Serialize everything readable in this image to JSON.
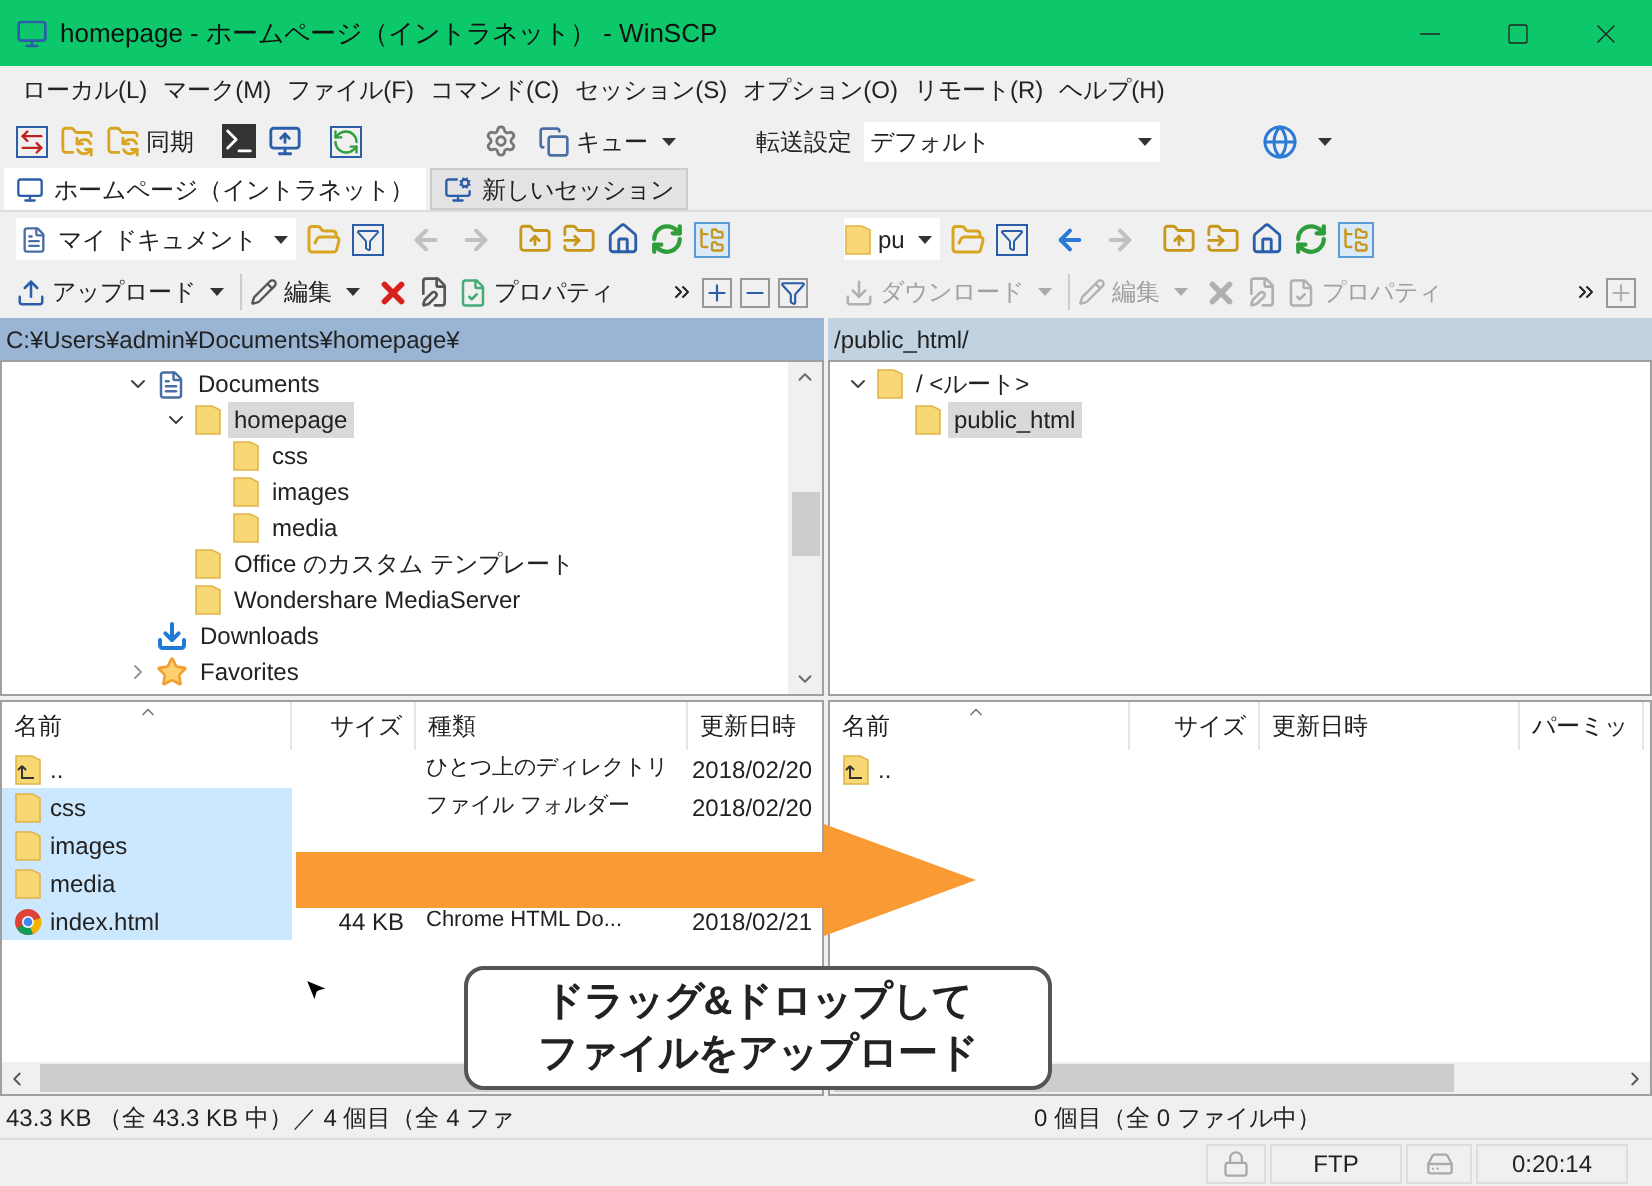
{
  "window": {
    "title": "homepage - ホームページ（イントラネット） - WinSCP"
  },
  "menu": [
    "ローカル(L)",
    "マーク(M)",
    "ファイル(F)",
    "コマンド(C)",
    "セッション(S)",
    "オプション(O)",
    "リモート(R)",
    "ヘルプ(H)"
  ],
  "toolbar": {
    "sync_label": "同期",
    "queue_label": "キュー",
    "transfer_label": "転送設定",
    "transfer_preset": "デフォルト"
  },
  "session_tabs": [
    {
      "label": "ホームページ（イントラネット）",
      "selected": true
    },
    {
      "label": "新しいセッション",
      "selected": false
    }
  ],
  "panels": [
    {
      "kind": "local",
      "location": "マイ ドキュメント",
      "actions_disabled": false,
      "transfer_action": "アップロード",
      "edit_action": "編集",
      "properties_action": "プロパティ",
      "path": "C:¥Users¥admin¥Documents¥homepage¥",
      "tree": [
        {
          "label": "Documents",
          "kind": "documents",
          "expanded": true,
          "selected": false,
          "children": [
            {
              "label": "homepage",
              "kind": "folder",
              "expanded": true,
              "selected": true,
              "children": [
                {
                  "label": "css",
                  "kind": "folder",
                  "selected": false
                },
                {
                  "label": "images",
                  "kind": "folder",
                  "selected": false
                },
                {
                  "label": "media",
                  "kind": "folder",
                  "selected": false
                }
              ]
            },
            {
              "label": "Office のカスタム テンプレート",
              "kind": "folder",
              "selected": false
            },
            {
              "label": "Wondershare MediaServer",
              "kind": "folder",
              "selected": false
            }
          ]
        },
        {
          "label": "Downloads",
          "kind": "download",
          "selected": false
        },
        {
          "label": "Favorites",
          "kind": "favorites",
          "expanded": false,
          "selected": false
        }
      ],
      "columns": [
        "名前",
        "サイズ",
        "種類",
        "更新日時"
      ],
      "files": [
        {
          "name": "..",
          "kind": "parent",
          "type": "ひとつ上のディレクトリ",
          "modified": "2018/02/20",
          "selected": false
        },
        {
          "name": "css",
          "kind": "folder",
          "type": "ファイル フォルダー",
          "modified": "2018/02/20",
          "selected": true
        },
        {
          "name": "images",
          "kind": "folder",
          "selected": true
        },
        {
          "name": "media",
          "kind": "folder",
          "selected": true
        },
        {
          "name": "index.html",
          "kind": "html",
          "size": "44 KB",
          "type": "Chrome HTML Do...",
          "modified": "2018/02/21",
          "selected": true
        }
      ],
      "status": "43.3 KB （全 43.3 KB 中）／ 4 個目（全 4 ファ"
    },
    {
      "kind": "remote",
      "location": "pu",
      "actions_disabled": true,
      "transfer_action": "ダウンロード",
      "edit_action": "編集",
      "properties_action": "プロパティ",
      "path": "/public_html/",
      "tree": [
        {
          "label": "/ <ルート>",
          "kind": "folder",
          "expanded": true,
          "selected": false,
          "children": [
            {
              "label": "public_html",
              "kind": "folder",
              "selected": true
            }
          ]
        }
      ],
      "columns": [
        "名前",
        "サイズ",
        "更新日時",
        "パーミッ"
      ],
      "files": [
        {
          "name": "..",
          "kind": "parent",
          "selected": false
        }
      ],
      "status": "0 個目（全 0 ファイル中）"
    }
  ],
  "callout": {
    "lines": [
      "ドラッグ&ドロップして",
      "ファイルをアップロード"
    ]
  },
  "status_bar": {
    "protocol": "FTP",
    "elapsed": "0:20:14"
  }
}
